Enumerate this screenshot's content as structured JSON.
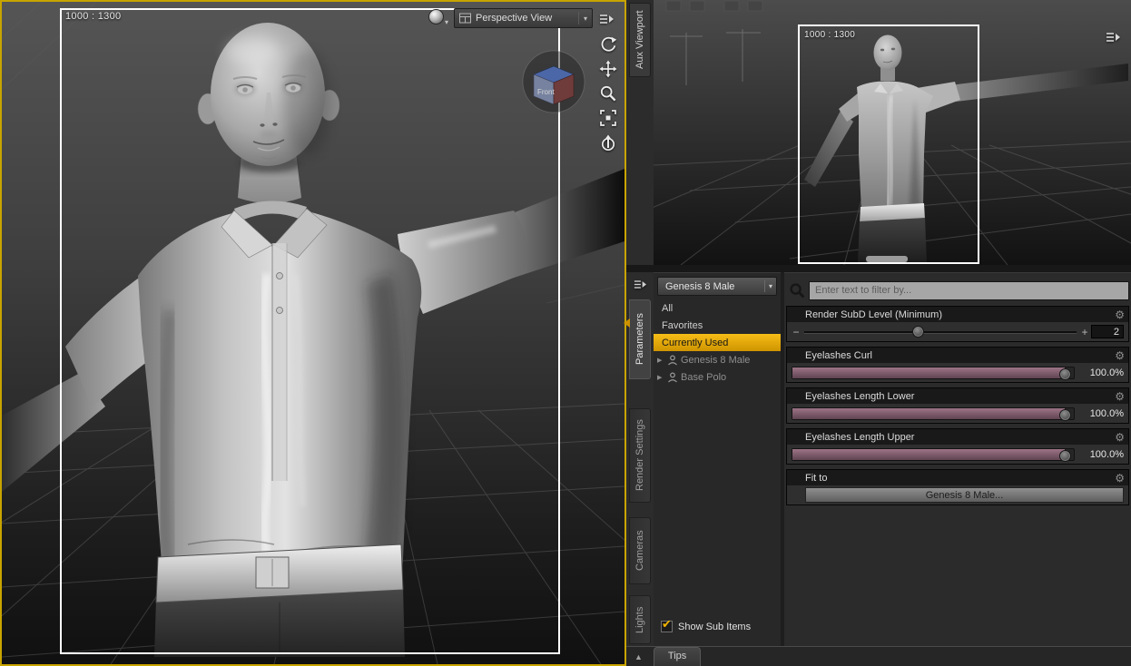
{
  "main_viewport": {
    "aspect_label": "1000 : 1300",
    "view_selector_label": "Perspective View",
    "nav_cube_front_label": "Front"
  },
  "aux_viewport": {
    "tab_label": "Aux Viewport",
    "aspect_label": "1000 : 1300"
  },
  "pane_tabs": {
    "parameters": "Parameters",
    "render_settings": "Render Settings",
    "cameras": "Cameras",
    "lights": "Lights"
  },
  "scene_panel": {
    "selector_value": "Genesis 8 Male",
    "items": [
      {
        "label": "All"
      },
      {
        "label": "Favorites"
      },
      {
        "label": "Currently Used"
      },
      {
        "label": "Genesis 8 Male"
      },
      {
        "label": "Base Polo"
      }
    ],
    "show_sub_items_label": "Show Sub Items"
  },
  "params_panel": {
    "filter_placeholder": "Enter text to filter by...",
    "minus_label": "−",
    "plus_label": "+",
    "groups": [
      {
        "label": "Render SubD Level (Minimum)",
        "value": "2",
        "thumb_left": "42%"
      },
      {
        "label": "Eyelashes Curl",
        "value": "100.0%",
        "fill": "97%"
      },
      {
        "label": "Eyelashes Length Lower",
        "value": "100.0%",
        "fill": "97%"
      },
      {
        "label": "Eyelashes Length Upper",
        "value": "100.0%",
        "fill": "97%"
      },
      {
        "label": "Fit to",
        "button_label": "Genesis 8 Male..."
      }
    ]
  },
  "bottom_bar": {
    "tips_label": "Tips"
  },
  "icons": {
    "gear": "⚙",
    "check": "✔",
    "dropdown_caret": "▾",
    "expand_arrow": "▶",
    "up_arrow": "▲"
  },
  "colors": {
    "active_pane_border": "#c8a400",
    "selection_yellow": "#e9ae0e",
    "slider_fill_mauve": "#8a5f6e"
  }
}
